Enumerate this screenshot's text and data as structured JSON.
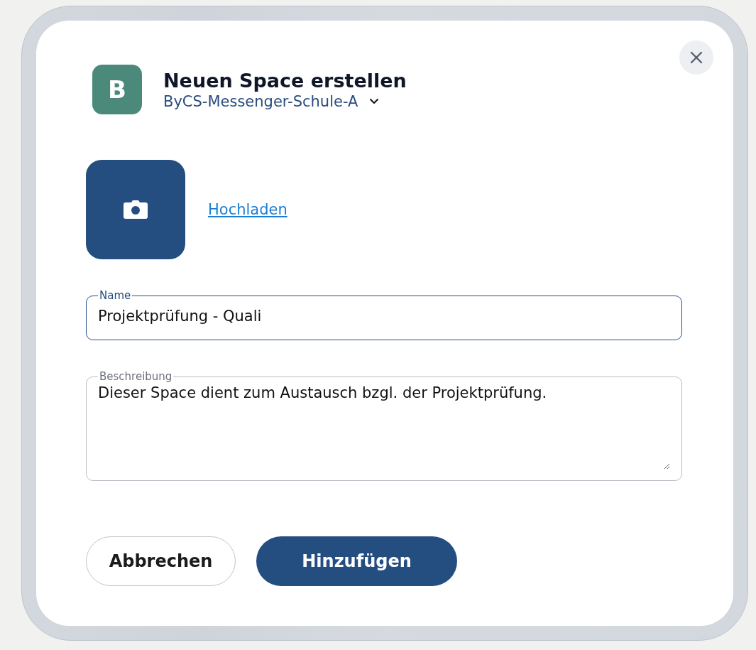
{
  "dialog": {
    "title": "Neuen Space erstellen",
    "avatar": {
      "letter": "B",
      "color": "#4b8a7b"
    },
    "workspace": {
      "name": "ByCS-Messenger-Schule-A"
    },
    "upload": {
      "link": "Hochladen"
    },
    "fields": [
      {
        "kind": "input",
        "label": "Name",
        "value": "Projektprüfung - Quali",
        "focused": true
      },
      {
        "kind": "textarea",
        "label": "Beschreibung",
        "value": "Dieser Space dient zum Austausch bzgl. der Projektprüfung.",
        "focused": false
      }
    ],
    "buttons": [
      {
        "label": "Abbrechen",
        "kind": "secondary"
      },
      {
        "label": "Hinzufügen",
        "kind": "primary"
      }
    ]
  }
}
